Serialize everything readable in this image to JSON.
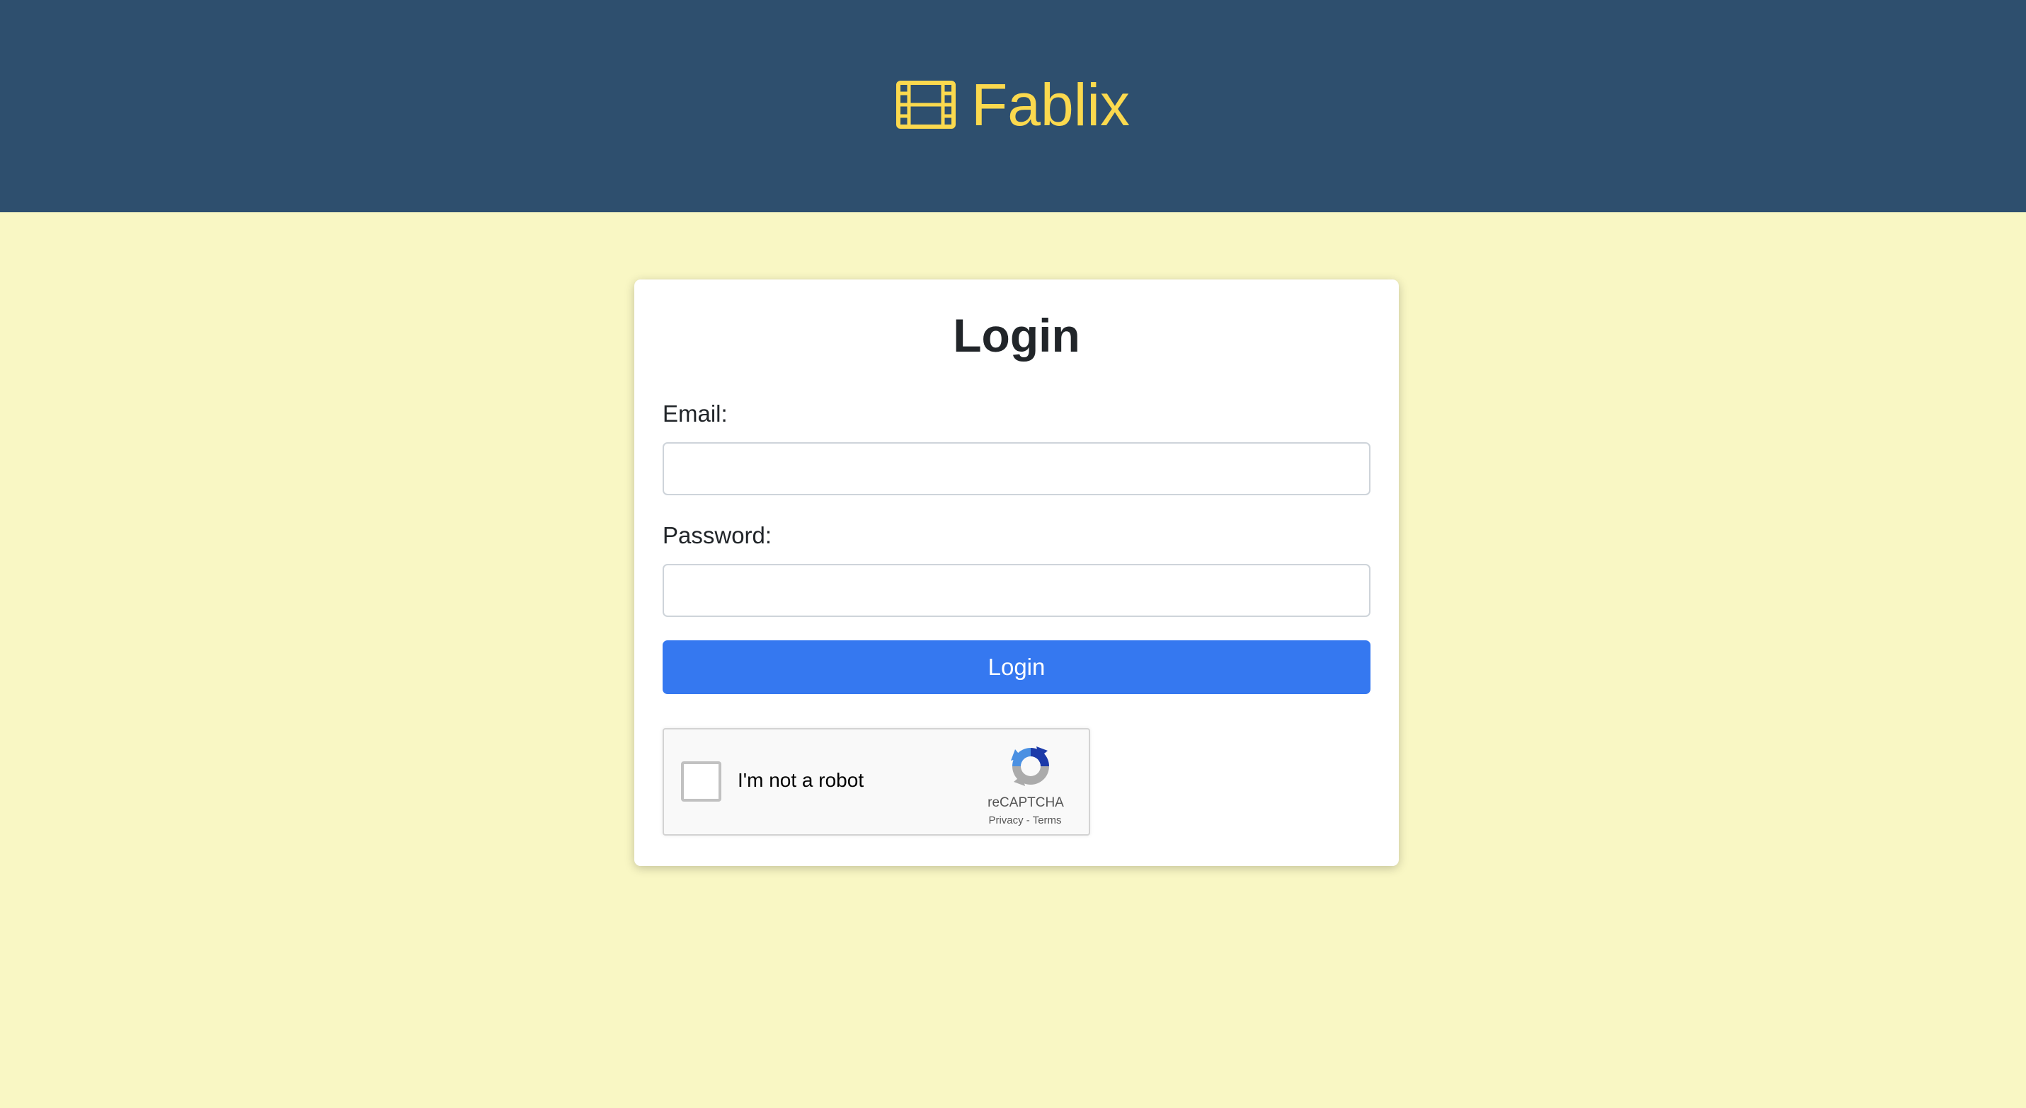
{
  "header": {
    "brand_icon": "film-icon",
    "brand_title": "Fablix",
    "background_color": "#2e4f6e",
    "brand_color": "#fbd94e"
  },
  "page": {
    "background_color": "#f9f7c4"
  },
  "login_form": {
    "title": "Login",
    "email_label": "Email:",
    "email_value": "",
    "password_label": "Password:",
    "password_value": "",
    "submit_label": "Login",
    "submit_color": "#3578f0"
  },
  "recaptcha": {
    "checkbox_label": "I'm not a robot",
    "checked": false,
    "logo_icon": "recaptcha-logo-icon",
    "brand": "reCAPTCHA",
    "privacy_label": "Privacy",
    "separator": "-",
    "terms_label": "Terms"
  }
}
